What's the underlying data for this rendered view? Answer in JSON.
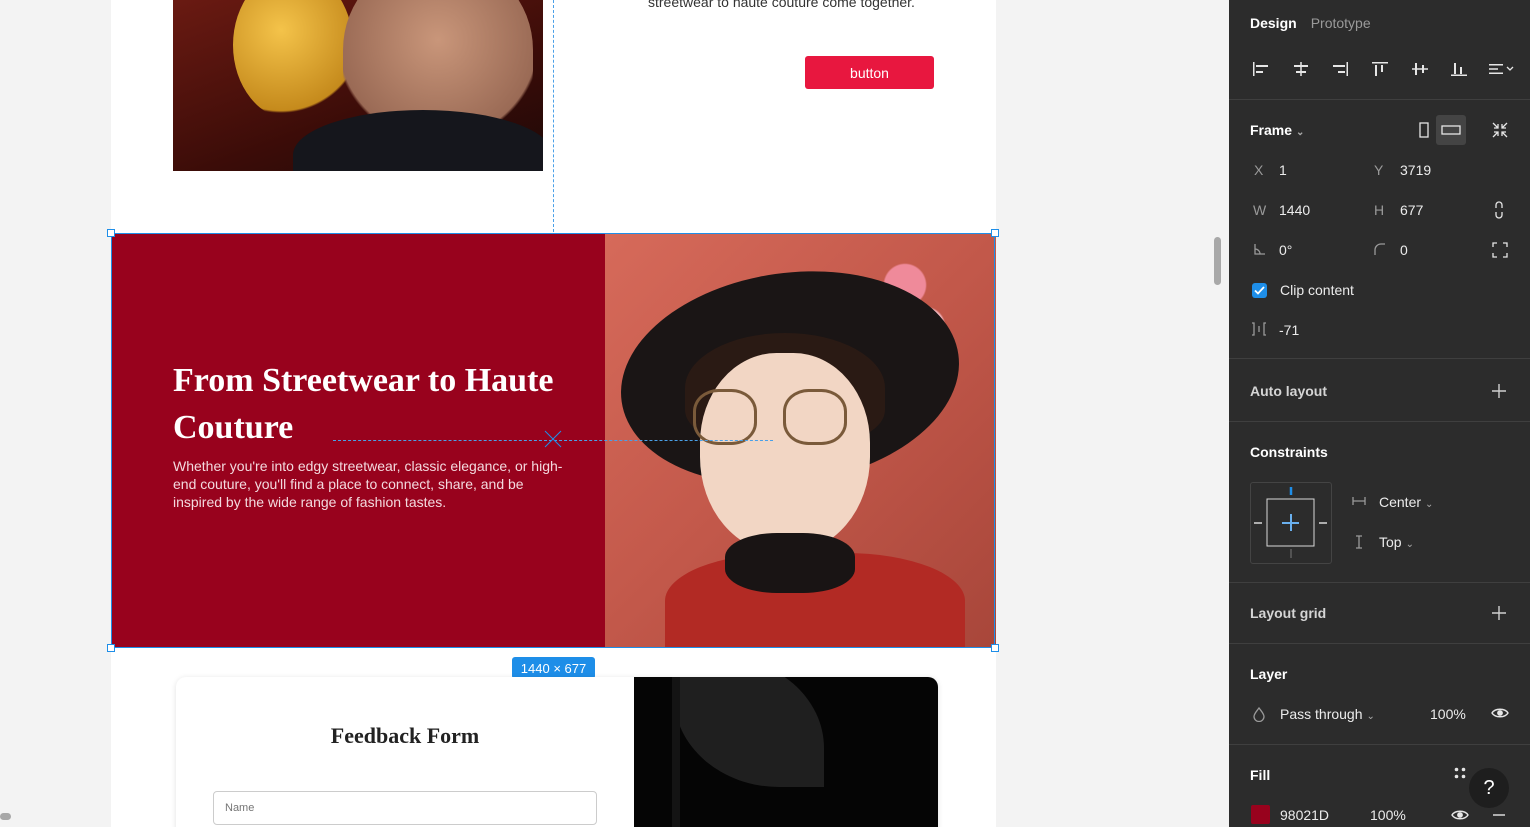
{
  "canvas": {
    "hero_text": "streetwear to haute couture come together.",
    "cta_label": "button",
    "selected_frame": {
      "heading": "From Streetwear to Haute Couture",
      "body": "Whether you're into edgy streetwear, classic elegance, or high-end couture, you'll find a place to connect, share, and be inspired by the wide range of fashion tastes.",
      "size_badge": "1440 × 677",
      "background": "#98021d"
    },
    "feedback": {
      "title": "Feedback Form",
      "name_placeholder": "Name"
    }
  },
  "panel": {
    "tabs": [
      "Design",
      "Prototype"
    ],
    "align_icons": [
      "align-left-icon",
      "align-horizontal-center-icon",
      "align-right-icon",
      "align-top-icon",
      "align-vertical-center-icon",
      "align-bottom-icon",
      "distribute-icon"
    ],
    "frame": {
      "title": "Frame",
      "x_label": "X",
      "x": "1",
      "y_label": "Y",
      "y": "3719",
      "w_label": "W",
      "w": "1440",
      "h_label": "H",
      "h": "677",
      "rotation": "0°",
      "radius": "0",
      "clip_content": "Clip content",
      "spacing": "-71"
    },
    "auto_layout": "Auto layout",
    "constraints": {
      "title": "Constraints",
      "horizontal": "Center",
      "vertical": "Top"
    },
    "layout_grid": "Layout grid",
    "layer": {
      "title": "Layer",
      "blend": "Pass through",
      "opacity": "100%"
    },
    "fill": {
      "title": "Fill",
      "hex": "98021D",
      "opacity": "100%",
      "color": "#98021d"
    },
    "help": "?"
  }
}
